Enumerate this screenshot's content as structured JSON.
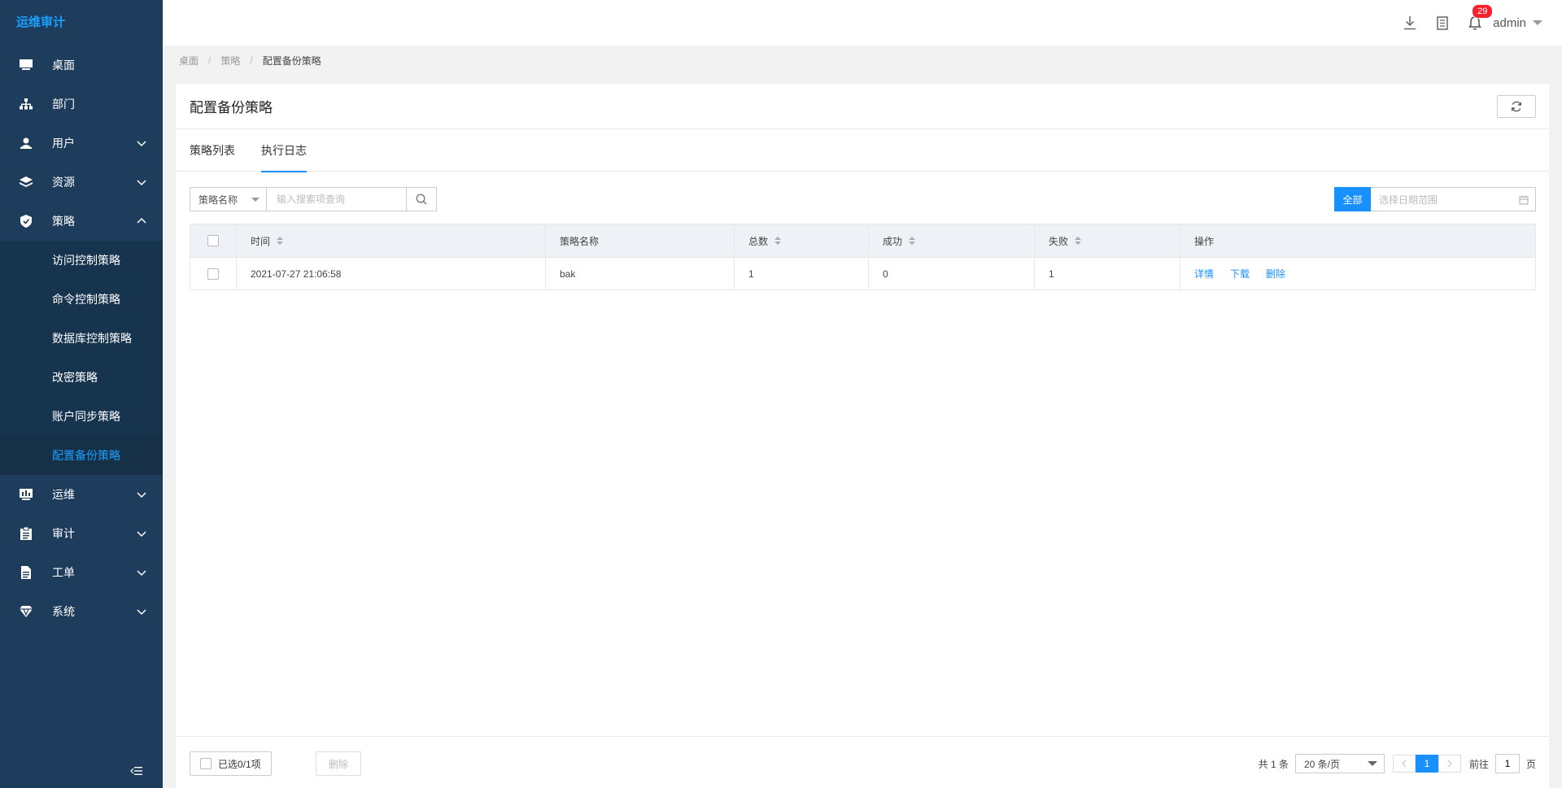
{
  "app": {
    "title": "运维审计"
  },
  "sidebar": {
    "items": [
      {
        "label": "桌面",
        "icon": "monitor-icon"
      },
      {
        "label": "部门",
        "icon": "org-chart-icon"
      },
      {
        "label": "用户",
        "icon": "user-icon"
      },
      {
        "label": "资源",
        "icon": "layers-icon"
      },
      {
        "label": "策略",
        "icon": "shield-icon",
        "expanded": true
      },
      {
        "label": "运维",
        "icon": "ops-screen-icon"
      },
      {
        "label": "审计",
        "icon": "clipboard-icon"
      },
      {
        "label": "工单",
        "icon": "document-icon"
      },
      {
        "label": "系统",
        "icon": "diamond-icon"
      }
    ],
    "submenu": [
      {
        "label": "访问控制策略"
      },
      {
        "label": "命令控制策略"
      },
      {
        "label": "数据库控制策略"
      },
      {
        "label": "改密策略"
      },
      {
        "label": "账户同步策略"
      },
      {
        "label": "配置备份策略",
        "active": true
      }
    ]
  },
  "header": {
    "notification_count": "29",
    "username": "admin"
  },
  "breadcrumb": [
    "桌面",
    "策略",
    "配置备份策略"
  ],
  "page": {
    "title": "配置备份策略",
    "tabs": [
      {
        "label": "策略列表"
      },
      {
        "label": "执行日志",
        "active": true
      }
    ]
  },
  "filters": {
    "field_select": "策略名称",
    "search_placeholder": "输入搜索项查询",
    "all_label": "全部",
    "date_placeholder": "选择日期范围"
  },
  "table": {
    "columns": [
      "时间",
      "策略名称",
      "总数",
      "成功",
      "失败",
      "操作"
    ],
    "rows": [
      {
        "time": "2021-07-27 21:06:58",
        "name": "bak",
        "total": "1",
        "success": "0",
        "failed": "1"
      }
    ],
    "actions": [
      "详情",
      "下载",
      "删除"
    ]
  },
  "footer": {
    "selected": "已选0/1项",
    "delete_label": "删除",
    "total_text": "共 1 条",
    "page_size": "20 条/页",
    "current_page": "1",
    "goto_prefix": "前往",
    "goto_value": "1",
    "goto_suffix": "页"
  },
  "colors": {
    "sidebar_bg": "#1e3d5c",
    "submenu_bg": "#17344f",
    "accent": "#1890ff",
    "badge": "#f5222d"
  }
}
